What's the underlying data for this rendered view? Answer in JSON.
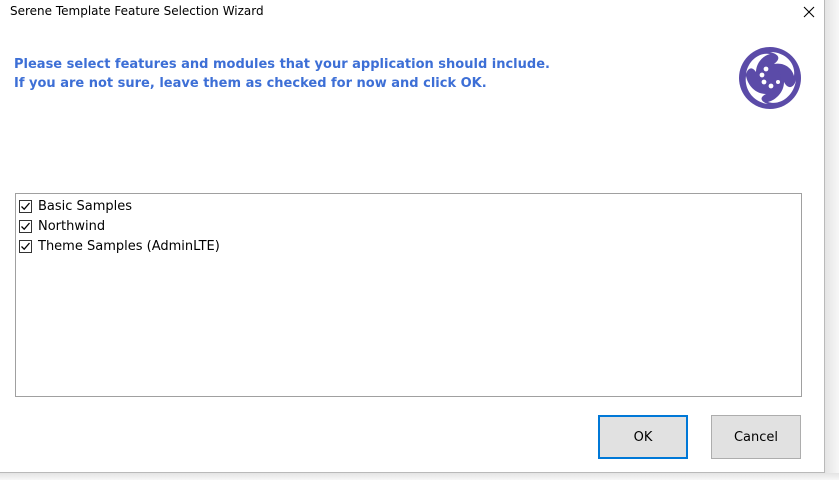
{
  "window": {
    "title": "Serene Template Feature Selection Wizard"
  },
  "header": {
    "line1": "Please select features and modules that your application should include.",
    "line2": "If you are not sure, leave them as checked for now and click OK."
  },
  "features": [
    {
      "label": "Basic Samples",
      "checked": true
    },
    {
      "label": "Northwind",
      "checked": true
    },
    {
      "label": "Theme Samples (AdminLTE)",
      "checked": true
    }
  ],
  "buttons": {
    "ok": "OK",
    "cancel": "Cancel"
  },
  "colors": {
    "accent": "#3d6fd6",
    "logo": "#5b4ba8",
    "focus": "#0078d7"
  },
  "icons": {
    "close": "close-icon",
    "logo": "serene-logo-icon",
    "check": "check-icon"
  }
}
